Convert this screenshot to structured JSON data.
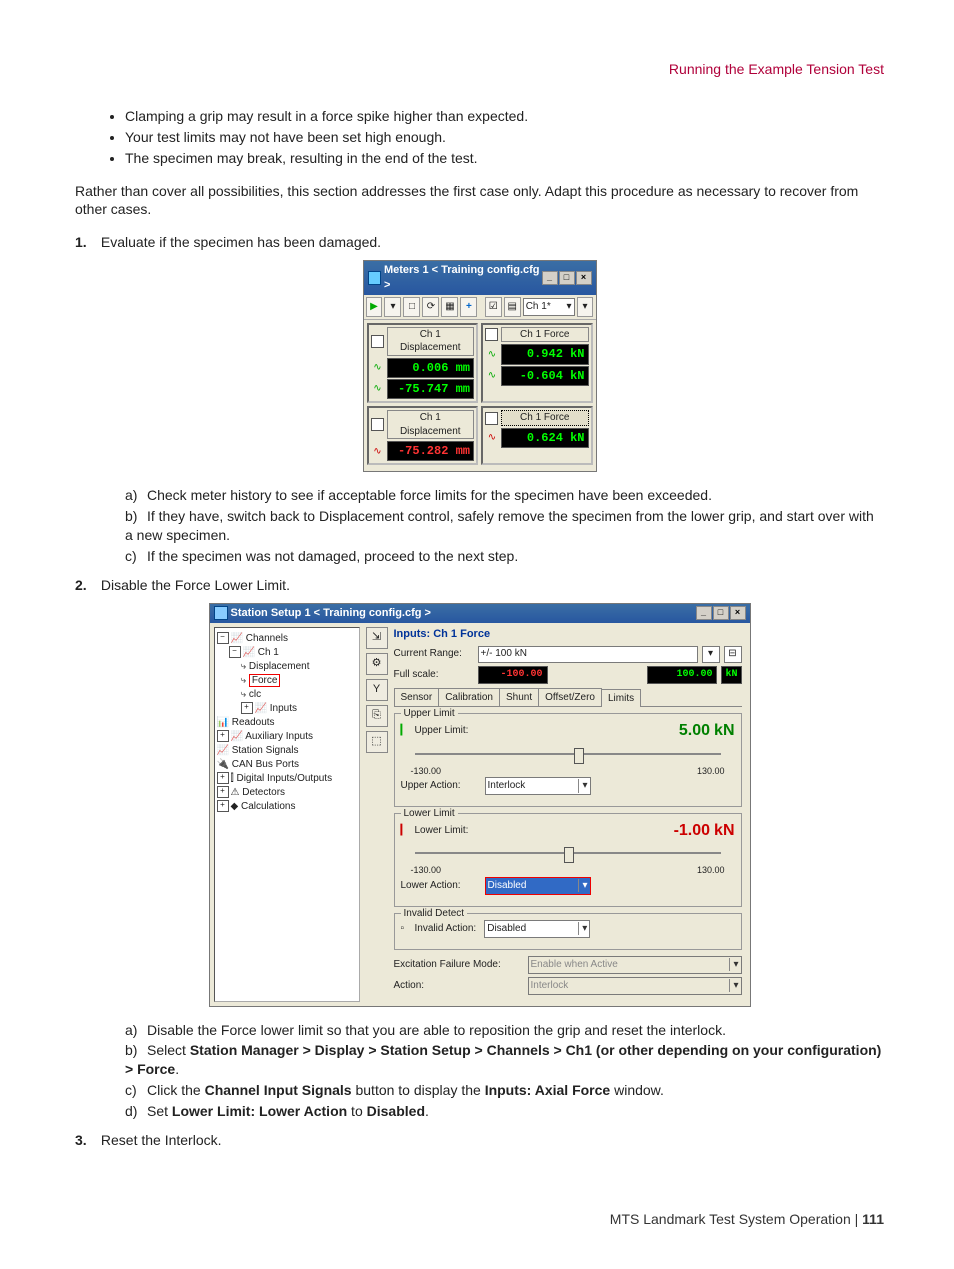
{
  "header": {
    "section_title": "Running the Example Tension Test"
  },
  "intro_bullets": [
    "Clamping a grip may result in a force spike higher than expected.",
    "Your test limits may not have been set high enough.",
    "The specimen may break, resulting in the end of the test."
  ],
  "intro_para": "Rather than cover all possibilities, this section addresses the first case only. Adapt this procedure as necessary to recover from other cases.",
  "steps": {
    "s1": {
      "num": "1.",
      "text": "Evaluate if the specimen has been damaged."
    },
    "s1a": {
      "l": "a)",
      "text": "Check meter history to see if acceptable force limits for the specimen have been exceeded."
    },
    "s1b": {
      "l": "b)",
      "text": "If they have, switch back to Displacement control, safely remove the specimen from the lower grip, and start over with a new specimen."
    },
    "s1c": {
      "l": "c)",
      "text": "If the specimen was not damaged, proceed to the next step."
    },
    "s2": {
      "num": "2.",
      "text": "Disable the Force Lower Limit."
    },
    "s2a": {
      "l": "a)",
      "text": "Disable the Force lower limit so that you are able to reposition the grip and reset the interlock."
    },
    "s2b": {
      "l": "b)",
      "pre": "Select ",
      "bold": "Station Manager > Display > Station Setup > Channels > Ch1 (or other depending on your configuration) > Force",
      "post": "."
    },
    "s2c": {
      "l": "c)",
      "pre": "Click the ",
      "b1": "Channel Input Signals",
      "mid": " button to display the ",
      "b2": "Inputs: Axial Force",
      "post": " window."
    },
    "s2d": {
      "l": "d)",
      "pre": "Set ",
      "b1": "Lower Limit: Lower Action",
      "mid": " to ",
      "b2": "Disabled",
      "post": "."
    },
    "s3": {
      "num": "3.",
      "text": "Reset the Interlock."
    }
  },
  "meters": {
    "title": "Meters 1 < Training config.cfg >",
    "combo": "Ch 1*",
    "r1c1_label": "Ch 1 Displacement",
    "r1c1_v1": "0.006 mm",
    "r1c1_v2": "-75.747 mm",
    "r1c2_label": "Ch 1 Force",
    "r1c2_v1": "0.942 kN",
    "r1c2_v2": "-0.604 kN",
    "r2c1_label": "Ch 1 Displacement",
    "r2c1_v1": "-75.282 mm",
    "r2c2_label": "Ch 1 Force",
    "r2c2_v1": "0.624 kN"
  },
  "station": {
    "title": "Station Setup 1 < Training config.cfg >",
    "tree": {
      "channels": "Channels",
      "ch1": "Ch 1",
      "disp": "Displacement",
      "force": "Force",
      "clc": "clc",
      "inputs": "Inputs",
      "readouts": "Readouts",
      "aux": "Auxiliary Inputs",
      "ssig": "Station Signals",
      "can": "CAN Bus Ports",
      "dio": "Digital Inputs/Outputs",
      "det": "Detectors",
      "calc": "Calculations"
    },
    "panel": {
      "title": "Inputs: Ch 1 Force",
      "cur_range_l": "Current Range:",
      "cur_range_v": "+/- 100 kN",
      "full_l": "Full scale:",
      "full_lo": "-100.00",
      "full_hi": "100.00",
      "full_u": "kN",
      "tabs": [
        "Sensor",
        "Calibration",
        "Shunt",
        "Offset/Zero",
        "Limits"
      ],
      "upper_group": "Upper Limit",
      "upper_l": "Upper Limit:",
      "upper_v": "5.00",
      "upper_u": "kN",
      "range_lo": "-130.00",
      "range_hi": "130.00",
      "upper_action_l": "Upper Action:",
      "upper_action_v": "Interlock",
      "lower_group": "Lower Limit",
      "lower_l": "Lower Limit:",
      "lower_v": "-1.00",
      "lower_u": "kN",
      "lower_action_l": "Lower Action:",
      "lower_action_v": "Disabled",
      "invalid_group": "Invalid Detect",
      "invalid_l": "Invalid Action:",
      "invalid_v": "Disabled",
      "efm_l": "Excitation Failure Mode:",
      "efm_v": "Enable when Active",
      "action_l": "Action:",
      "action_v": "Interlock"
    }
  },
  "footer": {
    "book": "MTS Landmark Test System Operation",
    "sep": " | ",
    "page": "111"
  }
}
